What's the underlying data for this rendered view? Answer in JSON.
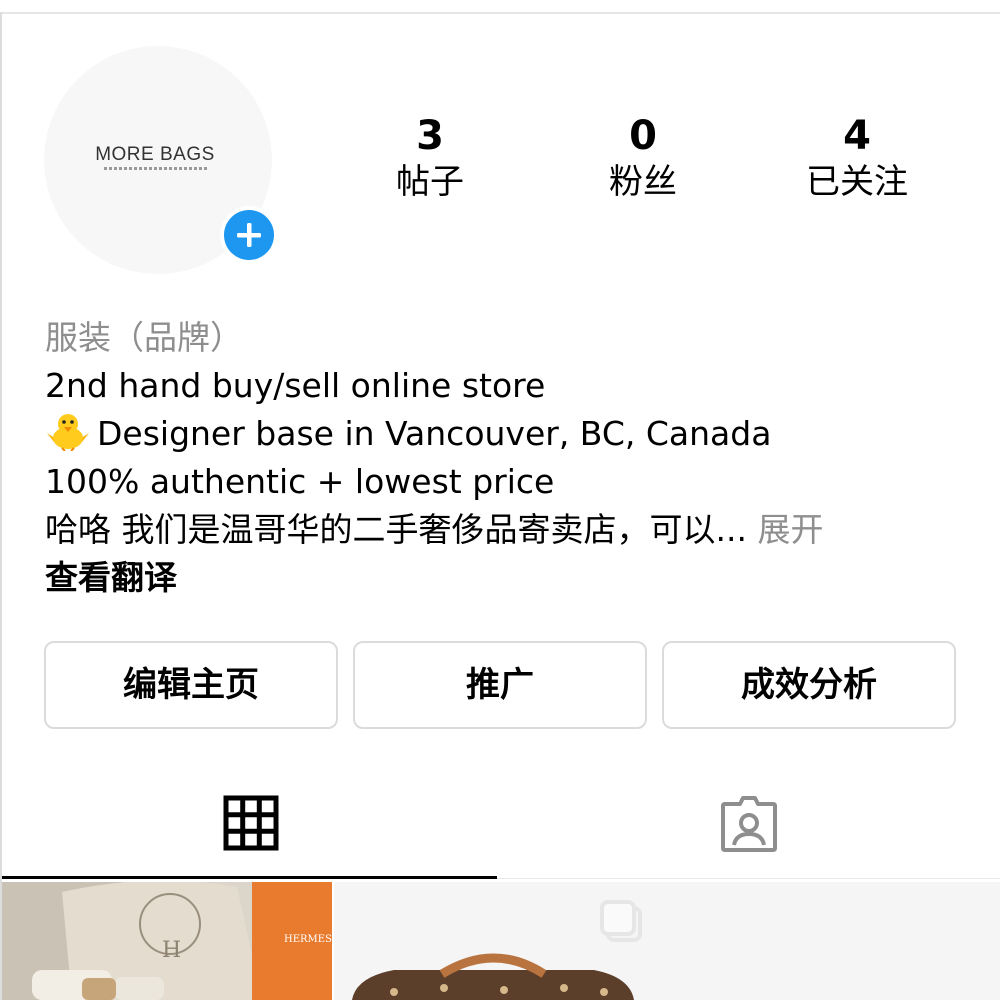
{
  "profile": {
    "avatar_logo": "MORE BAGS",
    "stats": {
      "posts": {
        "count": "3",
        "label": "帖子"
      },
      "followers": {
        "count": "0",
        "label": "粉丝"
      },
      "following": {
        "count": "4",
        "label": "已关注"
      }
    }
  },
  "bio": {
    "category": "服装（品牌）",
    "line1": "2nd hand buy/sell online store",
    "line2": "Designer base in Vancouver, BC, Canada",
    "line3": "100% authentic + lowest price",
    "line4": "哈咯 我们是温哥华的二手奢侈品寄卖店，可以...",
    "more": " 展开",
    "translate": "查看翻译"
  },
  "actions": {
    "edit_profile": "编辑主页",
    "promote": "推广",
    "insights": "成效分析"
  },
  "tabs": [
    "grid-icon",
    "tagged-icon"
  ],
  "colors": {
    "accent_blue": "#1d97f0",
    "muted_text": "#8e8e8e",
    "border": "#dbdbdb"
  }
}
